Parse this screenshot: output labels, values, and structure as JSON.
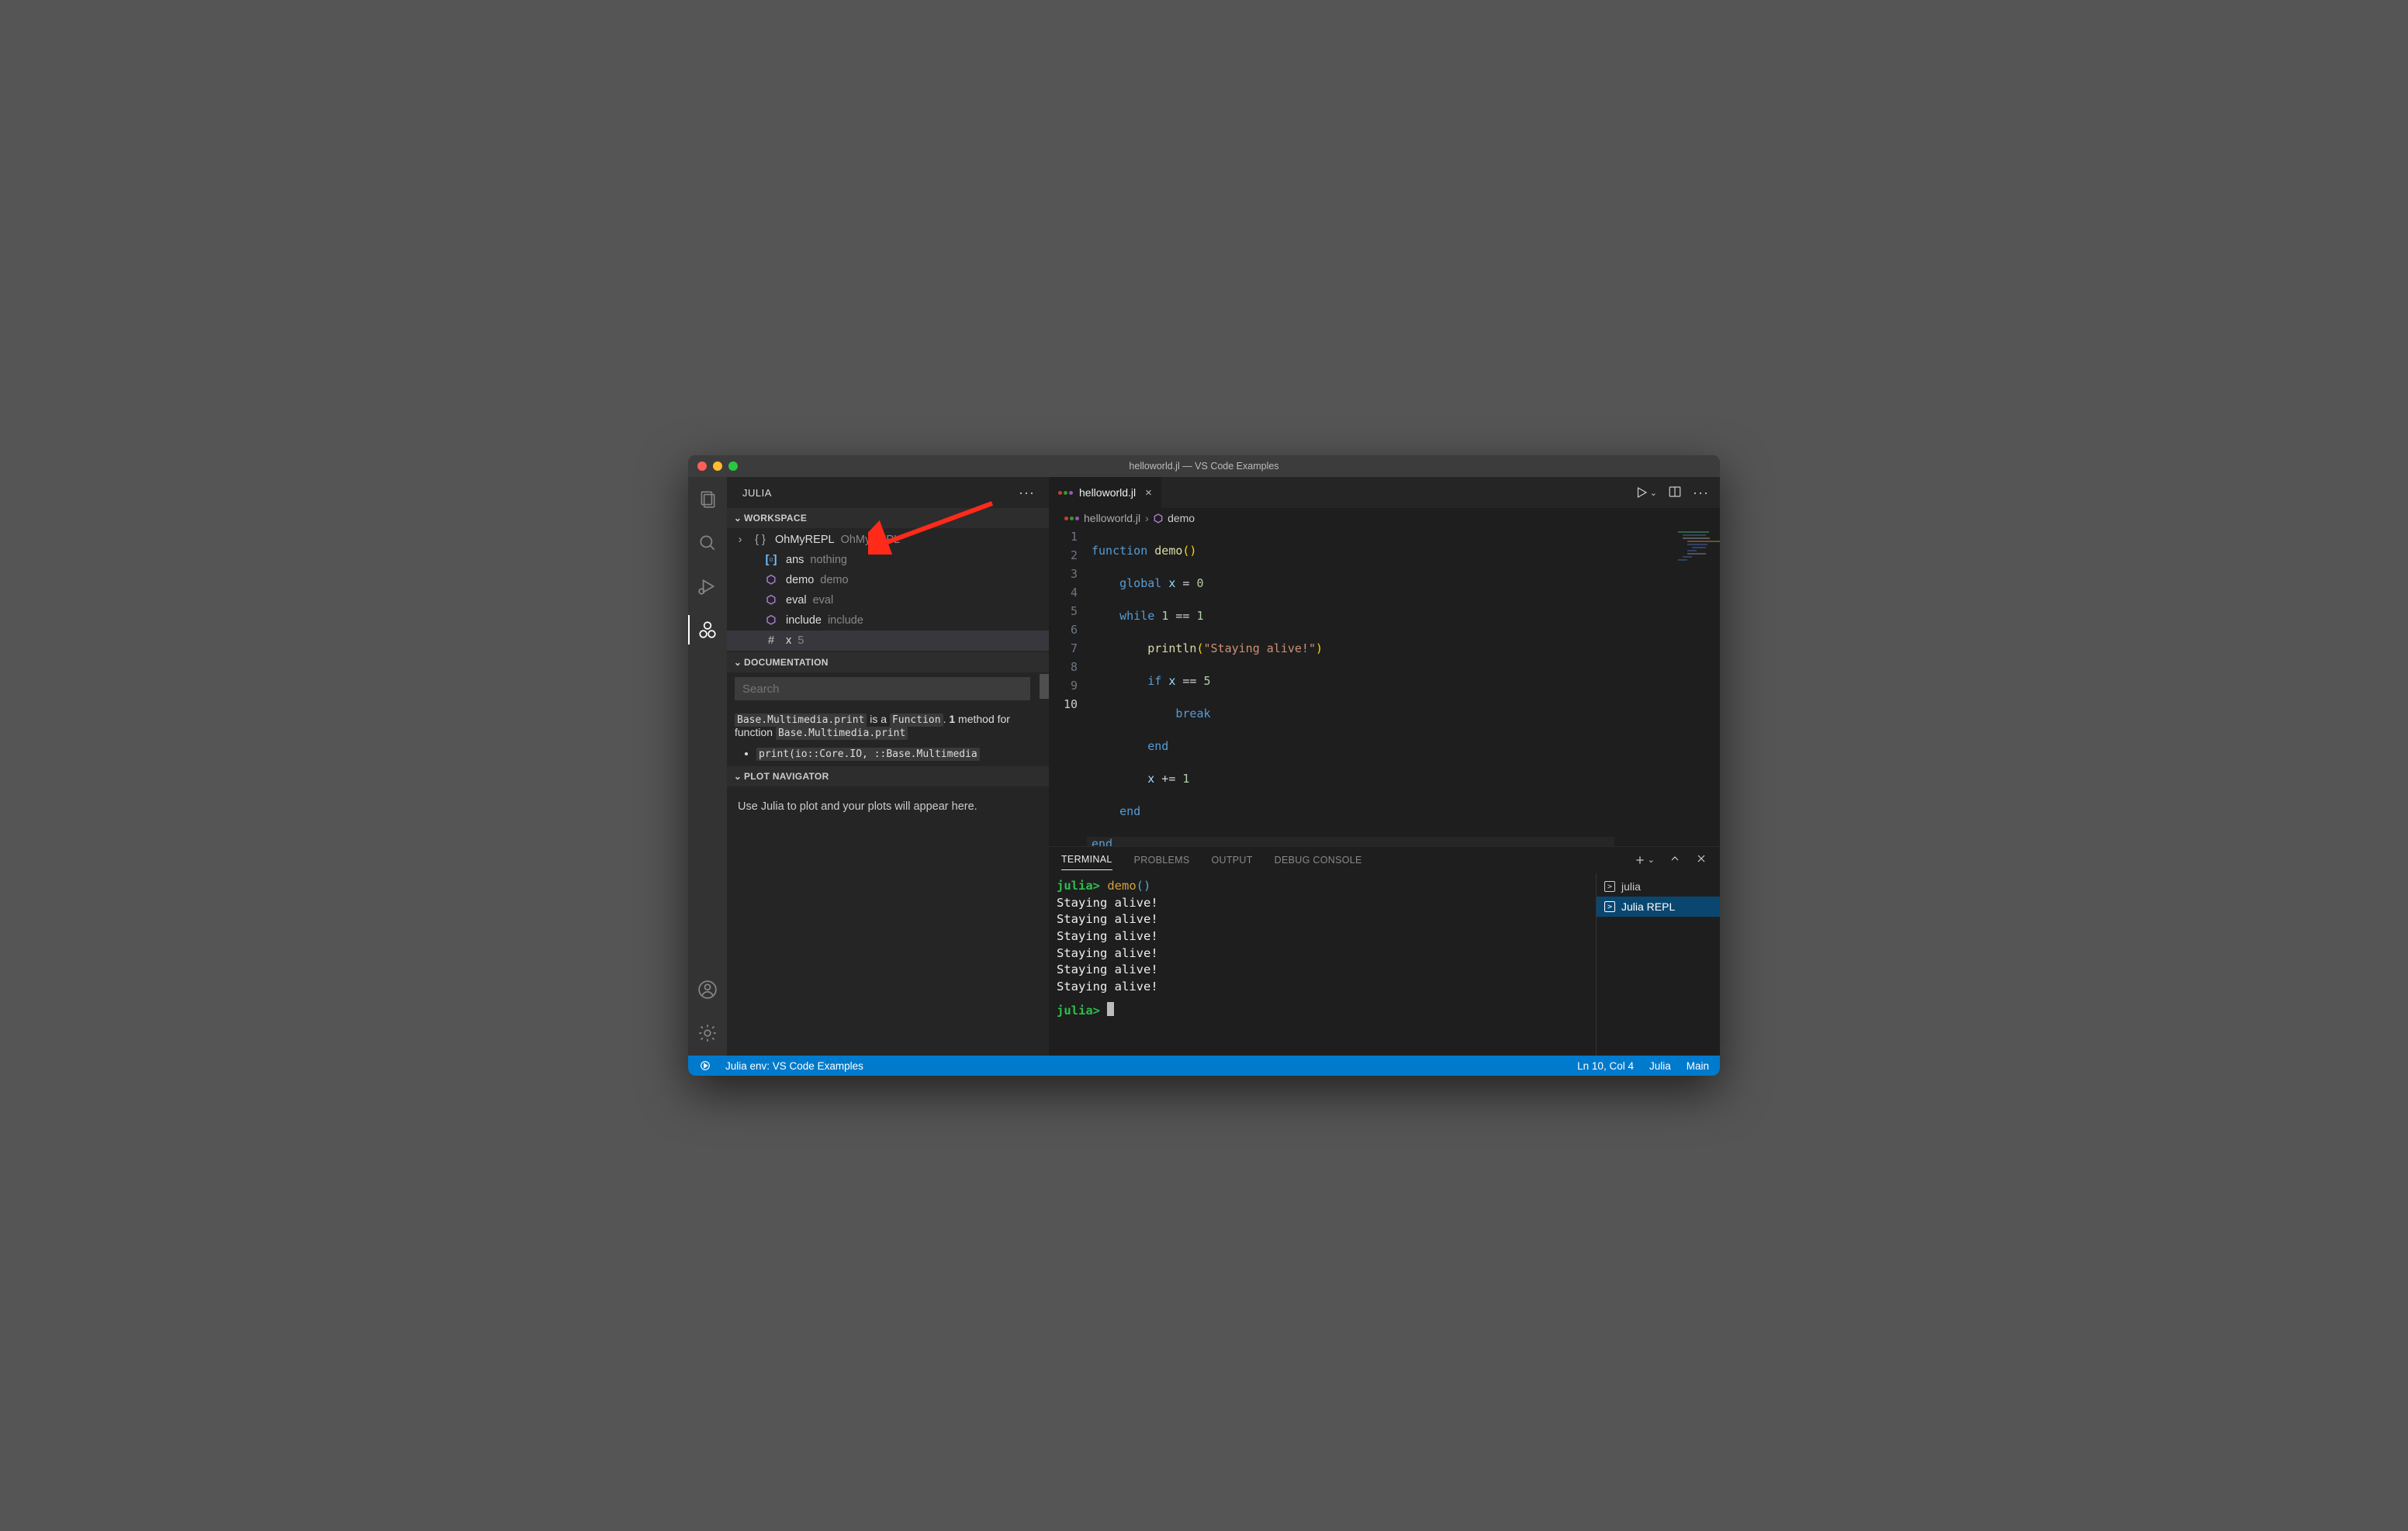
{
  "window": {
    "title": "helloworld.jl — VS Code Examples"
  },
  "sidebar": {
    "title": "JULIA",
    "sections": {
      "workspace": {
        "label": "WORKSPACE",
        "items": [
          {
            "icon": "braces",
            "name": "OhMyREPL",
            "detail": "OhMyREPL",
            "hasCaret": true
          },
          {
            "icon": "constant",
            "name": "ans",
            "detail": "nothing"
          },
          {
            "icon": "hex",
            "name": "demo",
            "detail": "demo"
          },
          {
            "icon": "hex",
            "name": "eval",
            "detail": "eval"
          },
          {
            "icon": "hex",
            "name": "include",
            "detail": "include"
          },
          {
            "icon": "hash",
            "name": "x",
            "detail": "5",
            "selected": true
          }
        ]
      },
      "documentation": {
        "label": "DOCUMENTATION",
        "search_placeholder": "Search",
        "text_pre1": "Base.Multimedia.print",
        "text_mid1": " is a ",
        "text_pre2": "Function",
        "text_mid2": ". ",
        "text_bold": "1",
        "text_tail": " method for function ",
        "text_pre3": "Base.Multimedia.print",
        "bullet1": "print(io::Core.IO, ::Base.Multimedia"
      },
      "plot": {
        "label": "PLOT NAVIGATOR",
        "body": "Use Julia to plot and your plots will appear here."
      }
    }
  },
  "editor": {
    "tab": {
      "filename": "helloworld.jl"
    },
    "breadcrumb": {
      "file": "helloworld.jl",
      "symbol": "demo"
    },
    "line_count": 10,
    "active_line": 10,
    "code": {
      "l1": {
        "a": "function ",
        "b": "demo",
        "c": "()"
      },
      "l2": {
        "a": "    global ",
        "b": "x",
        "c": " = ",
        "d": "0"
      },
      "l3": {
        "a": "    while ",
        "b": "1",
        "c": " == ",
        "d": "1"
      },
      "l4": {
        "a": "        ",
        "b": "println",
        "c": "(",
        "d": "\"Staying alive!\"",
        "e": ")"
      },
      "l5": {
        "a": "        if ",
        "b": "x",
        "c": " == ",
        "d": "5"
      },
      "l6": {
        "a": "            ",
        "b": "break"
      },
      "l7": {
        "a": "        end"
      },
      "l8": {
        "a": "        ",
        "b": "x",
        "c": " += ",
        "d": "1"
      },
      "l9": {
        "a": "    end"
      },
      "l10": {
        "a": "end"
      }
    }
  },
  "panel": {
    "tabs": [
      "TERMINAL",
      "PROBLEMS",
      "OUTPUT",
      "DEBUG CONSOLE"
    ],
    "active": 0,
    "terminal": {
      "prompt": "julia>",
      "call": " demo",
      "callParens": "()",
      "output_line": "Staying alive!",
      "output_repeat": 6
    },
    "sessions": [
      {
        "name": "julia",
        "selected": false
      },
      {
        "name": "Julia REPL",
        "selected": true
      }
    ]
  },
  "status": {
    "env": "Julia env: VS Code Examples",
    "ln_col": "Ln 10, Col 4",
    "lang": "Julia",
    "branch": "Main"
  }
}
